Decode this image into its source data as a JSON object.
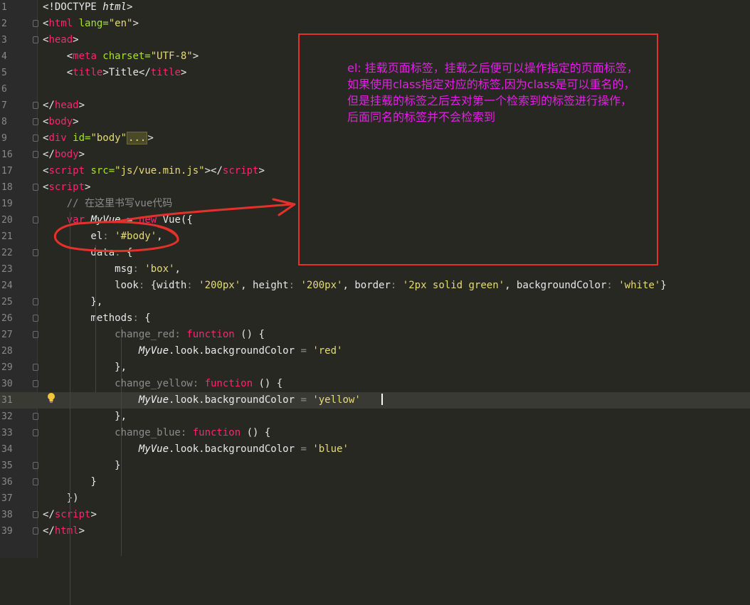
{
  "editor": {
    "lines": [
      {
        "num": "1",
        "parts": [
          {
            "c": "plain",
            "t": "<!DOCTYPE "
          },
          {
            "c": "ital",
            "t": "html"
          },
          {
            "c": "plain",
            "t": ">"
          }
        ]
      },
      {
        "num": "2",
        "parts": [
          {
            "c": "plain",
            "t": "<"
          },
          {
            "c": "tag",
            "t": "html"
          },
          {
            "c": "attr",
            "t": " lang="
          },
          {
            "c": "str",
            "t": "\"en\""
          },
          {
            "c": "plain",
            "t": ">"
          }
        ]
      },
      {
        "num": "3",
        "parts": [
          {
            "c": "plain",
            "t": "<"
          },
          {
            "c": "tag",
            "t": "head"
          },
          {
            "c": "plain",
            "t": ">"
          }
        ]
      },
      {
        "num": "4",
        "parts": [
          {
            "c": "plain",
            "t": "    <"
          },
          {
            "c": "tag",
            "t": "meta"
          },
          {
            "c": "attr",
            "t": " charset="
          },
          {
            "c": "str",
            "t": "\"UTF-8\""
          },
          {
            "c": "plain",
            "t": ">"
          }
        ]
      },
      {
        "num": "5",
        "parts": [
          {
            "c": "plain",
            "t": "    <"
          },
          {
            "c": "tag",
            "t": "title"
          },
          {
            "c": "plain",
            "t": ">Title</"
          },
          {
            "c": "tag",
            "t": "title"
          },
          {
            "c": "plain",
            "t": ">"
          }
        ]
      },
      {
        "num": "6",
        "parts": []
      },
      {
        "num": "7",
        "parts": [
          {
            "c": "plain",
            "t": "</"
          },
          {
            "c": "tag",
            "t": "head"
          },
          {
            "c": "plain",
            "t": ">"
          }
        ]
      },
      {
        "num": "8",
        "parts": [
          {
            "c": "plain",
            "t": "<"
          },
          {
            "c": "tag",
            "t": "body"
          },
          {
            "c": "plain",
            "t": ">"
          }
        ]
      },
      {
        "num": "9",
        "parts": [
          {
            "c": "plain",
            "t": "<"
          },
          {
            "c": "tag",
            "t": "div"
          },
          {
            "c": "attr",
            "t": " id="
          },
          {
            "c": "str",
            "t": "\"body\""
          },
          {
            "c": "fold-collapsed",
            "t": "..."
          },
          {
            "c": "plain",
            "t": ">"
          }
        ]
      },
      {
        "num": "16",
        "parts": [
          {
            "c": "plain",
            "t": "</"
          },
          {
            "c": "tag",
            "t": "body"
          },
          {
            "c": "plain",
            "t": ">"
          }
        ]
      },
      {
        "num": "17",
        "parts": [
          {
            "c": "plain",
            "t": "<"
          },
          {
            "c": "tag",
            "t": "script"
          },
          {
            "c": "attr",
            "t": " src="
          },
          {
            "c": "str",
            "t": "\"js/vue.min.js\""
          },
          {
            "c": "plain",
            "t": "></"
          },
          {
            "c": "tag",
            "t": "script"
          },
          {
            "c": "plain",
            "t": ">"
          }
        ]
      },
      {
        "num": "18",
        "parts": [
          {
            "c": "plain",
            "t": "<"
          },
          {
            "c": "tag",
            "t": "script"
          },
          {
            "c": "plain",
            "t": ">"
          }
        ]
      },
      {
        "num": "19",
        "parts": [
          {
            "c": "cmt",
            "t": "    // 在这里书写vue代码"
          }
        ]
      },
      {
        "num": "20",
        "parts": [
          {
            "c": "kw",
            "t": "    var "
          },
          {
            "c": "ital",
            "t": "MyVue"
          },
          {
            "c": "plain",
            "t": " = "
          },
          {
            "c": "kw",
            "t": "new "
          },
          {
            "c": "plain",
            "t": "Vue({"
          }
        ]
      },
      {
        "num": "21",
        "parts": [
          {
            "c": "plain",
            "t": "        el"
          },
          {
            "c": "cmt",
            "t": ": "
          },
          {
            "c": "str",
            "t": "'#body'"
          },
          {
            "c": "plain",
            "t": ","
          }
        ]
      },
      {
        "num": "22",
        "parts": [
          {
            "c": "plain",
            "t": "        data"
          },
          {
            "c": "cmt",
            "t": ": "
          },
          {
            "c": "plain",
            "t": "{"
          }
        ]
      },
      {
        "num": "23",
        "parts": [
          {
            "c": "plain",
            "t": "            msg"
          },
          {
            "c": "cmt",
            "t": ": "
          },
          {
            "c": "str",
            "t": "'box'"
          },
          {
            "c": "plain",
            "t": ","
          }
        ]
      },
      {
        "num": "24",
        "parts": [
          {
            "c": "plain",
            "t": "            look"
          },
          {
            "c": "cmt",
            "t": ": "
          },
          {
            "c": "plain",
            "t": "{width"
          },
          {
            "c": "cmt",
            "t": ": "
          },
          {
            "c": "str",
            "t": "'200px'"
          },
          {
            "c": "plain",
            "t": ", height"
          },
          {
            "c": "cmt",
            "t": ": "
          },
          {
            "c": "str",
            "t": "'200px'"
          },
          {
            "c": "plain",
            "t": ", border"
          },
          {
            "c": "cmt",
            "t": ": "
          },
          {
            "c": "str",
            "t": "'2px solid green'"
          },
          {
            "c": "plain",
            "t": ", backgroundColor"
          },
          {
            "c": "cmt",
            "t": ": "
          },
          {
            "c": "str",
            "t": "'white'"
          },
          {
            "c": "plain",
            "t": "}"
          }
        ]
      },
      {
        "num": "25",
        "parts": [
          {
            "c": "plain",
            "t": "        },"
          }
        ]
      },
      {
        "num": "26",
        "parts": [
          {
            "c": "plain",
            "t": "        methods"
          },
          {
            "c": "cmt",
            "t": ": "
          },
          {
            "c": "plain",
            "t": "{"
          }
        ]
      },
      {
        "num": "27",
        "parts": [
          {
            "c": "cmt",
            "t": "            change_red: "
          },
          {
            "c": "kw",
            "t": "function"
          },
          {
            "c": "plain",
            "t": " () {"
          }
        ]
      },
      {
        "num": "28",
        "parts": [
          {
            "c": "plain",
            "t": "                "
          },
          {
            "c": "ital",
            "t": "MyVue"
          },
          {
            "c": "plain",
            "t": ".look.backgroundColor "
          },
          {
            "c": "cmt",
            "t": "= "
          },
          {
            "c": "str",
            "t": "'red'"
          }
        ]
      },
      {
        "num": "29",
        "parts": [
          {
            "c": "plain",
            "t": "            },"
          }
        ]
      },
      {
        "num": "30",
        "parts": [
          {
            "c": "cmt",
            "t": "            change_yellow: "
          },
          {
            "c": "kw",
            "t": "function"
          },
          {
            "c": "plain",
            "t": " () {"
          }
        ]
      },
      {
        "num": "31",
        "parts": [
          {
            "c": "plain",
            "t": "                "
          },
          {
            "c": "ital",
            "t": "MyVue"
          },
          {
            "c": "plain",
            "t": ".look.backgroundColor "
          },
          {
            "c": "cmt",
            "t": "= "
          },
          {
            "c": "str",
            "t": "'yellow'"
          }
        ]
      },
      {
        "num": "32",
        "parts": [
          {
            "c": "plain",
            "t": "            },"
          }
        ]
      },
      {
        "num": "33",
        "parts": [
          {
            "c": "cmt",
            "t": "            change_blue: "
          },
          {
            "c": "kw",
            "t": "function"
          },
          {
            "c": "plain",
            "t": " () {"
          }
        ]
      },
      {
        "num": "34",
        "parts": [
          {
            "c": "plain",
            "t": "                "
          },
          {
            "c": "ital",
            "t": "MyVue"
          },
          {
            "c": "plain",
            "t": ".look.backgroundColor "
          },
          {
            "c": "cmt",
            "t": "= "
          },
          {
            "c": "str",
            "t": "'blue'"
          }
        ]
      },
      {
        "num": "35",
        "parts": [
          {
            "c": "plain",
            "t": "            }"
          }
        ]
      },
      {
        "num": "36",
        "parts": [
          {
            "c": "plain",
            "t": "        }"
          }
        ]
      },
      {
        "num": "37",
        "parts": [
          {
            "c": "plain",
            "t": "    })"
          }
        ]
      },
      {
        "num": "38",
        "parts": [
          {
            "c": "plain",
            "t": "</"
          },
          {
            "c": "tag",
            "t": "script"
          },
          {
            "c": "plain",
            "t": ">"
          }
        ]
      },
      {
        "num": "39",
        "parts": [
          {
            "c": "plain",
            "t": "</"
          },
          {
            "c": "tag",
            "t": "html"
          },
          {
            "c": "plain",
            "t": ">"
          }
        ]
      }
    ],
    "current_line": "31",
    "folded_lines": [
      "2",
      "3",
      "7",
      "8",
      "9",
      "16",
      "18",
      "20",
      "22",
      "25",
      "26",
      "27",
      "29",
      "30",
      "32",
      "33",
      "35",
      "36",
      "38",
      "39"
    ]
  },
  "annotation": {
    "text": "el: 挂载页面标签，挂载之后便可以操作指定的页面标签，如果使用class指定对应的标签,因为class是可以重名的，但是挂载的标签之后去对第一个检索到的标签进行操作，后面同名的标签并不会检索到",
    "box_color": "#e5312b",
    "text_color": "#e61fe6"
  },
  "icons": {
    "bulb": "lightbulb-icon"
  }
}
